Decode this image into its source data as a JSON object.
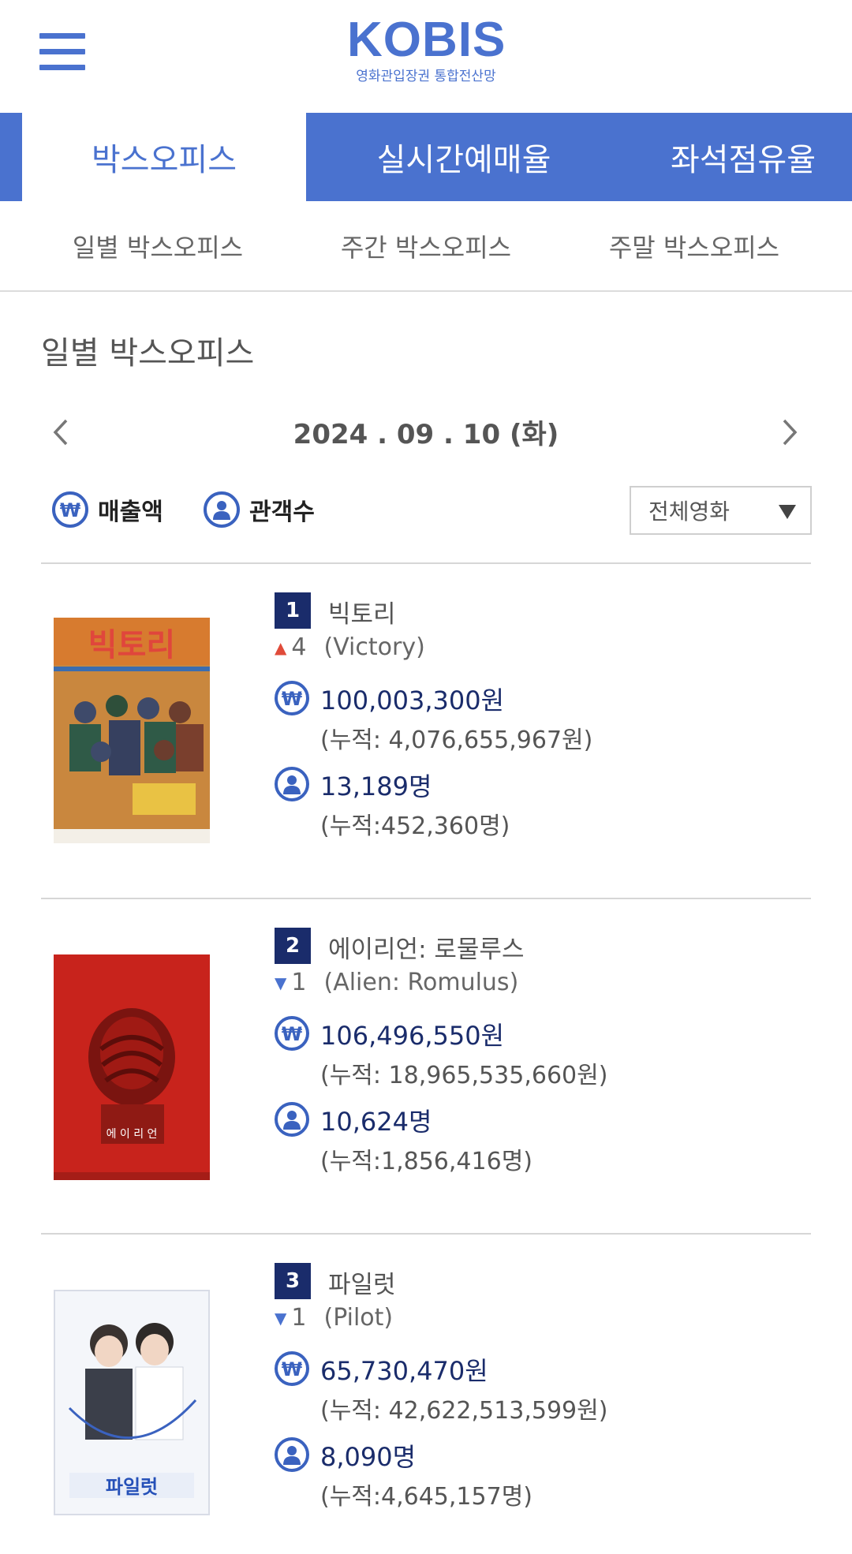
{
  "header": {
    "logo": "KOBIS",
    "logo_sub": "영화관입장권 통합전산망"
  },
  "main_tabs": [
    {
      "label": "박스오피스",
      "active": true
    },
    {
      "label": "실시간예매율",
      "active": false
    },
    {
      "label": "좌석점유율",
      "active": false
    }
  ],
  "sub_tabs": [
    {
      "label": "일별 박스오피스"
    },
    {
      "label": "주간 박스오피스"
    },
    {
      "label": "주말 박스오피스"
    }
  ],
  "section_title": "일별 박스오피스",
  "date": "2024 . 09 . 10 (화)",
  "toggles": {
    "sales_label": "매출액",
    "audience_label": "관객수"
  },
  "filter": {
    "selected": "전체영화"
  },
  "colors": {
    "brand": "#4a72cf",
    "rank_badge": "#1a2c6b",
    "up": "#e04b3a",
    "down": "#4a72cf"
  },
  "movies": [
    {
      "rank": "1",
      "title_ko": "빅토리",
      "change_dir": "up",
      "change": "4",
      "title_en": "(Victory)",
      "sales": "100,003,300원",
      "sales_acc": "(누적: 4,076,655,967원)",
      "audience": "13,189명",
      "audience_acc": "(누적:452,360명)",
      "poster_text": "빅토리"
    },
    {
      "rank": "2",
      "title_ko": "에이리언: 로물루스",
      "change_dir": "down",
      "change": "1",
      "title_en": "(Alien: Romulus)",
      "sales": "106,496,550원",
      "sales_acc": "(누적: 18,965,535,660원)",
      "audience": "10,624명",
      "audience_acc": "(누적:1,856,416명)",
      "poster_text": "에 이 리 언"
    },
    {
      "rank": "3",
      "title_ko": "파일럿",
      "change_dir": "down",
      "change": "1",
      "title_en": "(Pilot)",
      "sales": "65,730,470원",
      "sales_acc": "(누적: 42,622,513,599원)",
      "audience": "8,090명",
      "audience_acc": "(누적:4,645,157명)",
      "poster_text": "파일럿"
    }
  ]
}
